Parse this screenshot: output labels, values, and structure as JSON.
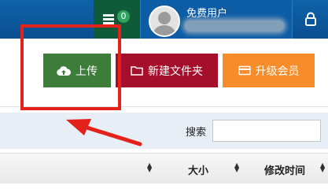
{
  "header": {
    "notification_count": "0",
    "username": "免费用户"
  },
  "toolbar": {
    "upload_label": "上传",
    "new_folder_label": "新建文件夹",
    "upgrade_label": "升级会员"
  },
  "search": {
    "label": "搜索",
    "value": "",
    "placeholder": ""
  },
  "table": {
    "columns": [
      "大小",
      "修改时间"
    ]
  },
  "colors": {
    "topbar": "#0f62a9",
    "upload_button": "#3d7d3a",
    "new_folder_button": "#a50f2c",
    "upgrade_button": "#f78c2a",
    "annotation": "#e3221c"
  },
  "icons": {
    "menu": "hamburger-icon",
    "logout": "lock-icon",
    "upload": "cloud-upload-icon",
    "folder": "folder-icon",
    "vip": "card-icon",
    "sort": "sort-icon"
  }
}
